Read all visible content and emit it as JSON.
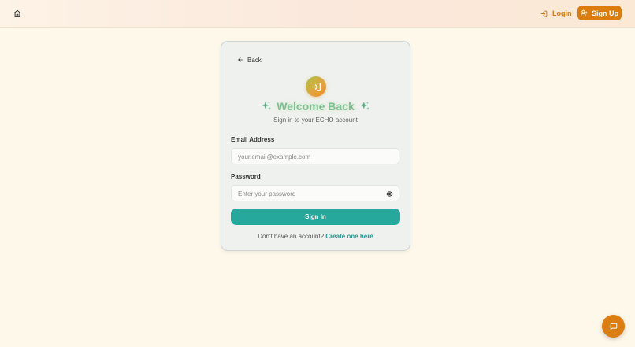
{
  "nav": {
    "home_icon": "home-icon",
    "login_label": "Login",
    "login_icon": "login-icon",
    "signup_label": "Sign Up",
    "signup_icon": "user-plus-icon"
  },
  "card": {
    "back_label": "Back",
    "logo_icon": "sign-in-icon",
    "title": "Welcome Back",
    "title_sparkle": "✨",
    "subtitle": "Sign in to your ECHO account",
    "email": {
      "label": "Email Address",
      "value": "",
      "placeholder": "your.email@example.com"
    },
    "password": {
      "label": "Password",
      "value": "",
      "placeholder": "Enter your password"
    },
    "submit_label": "Sign In",
    "footer_prompt": "Don't have an account?",
    "footer_link": "Create one here"
  },
  "chat": {
    "icon": "chat-icon"
  },
  "colors": {
    "accent_orange": "#dc7c0d",
    "accent_teal": "#27a89d",
    "title_green": "#7fbf96",
    "background": "#fdf8ea"
  }
}
